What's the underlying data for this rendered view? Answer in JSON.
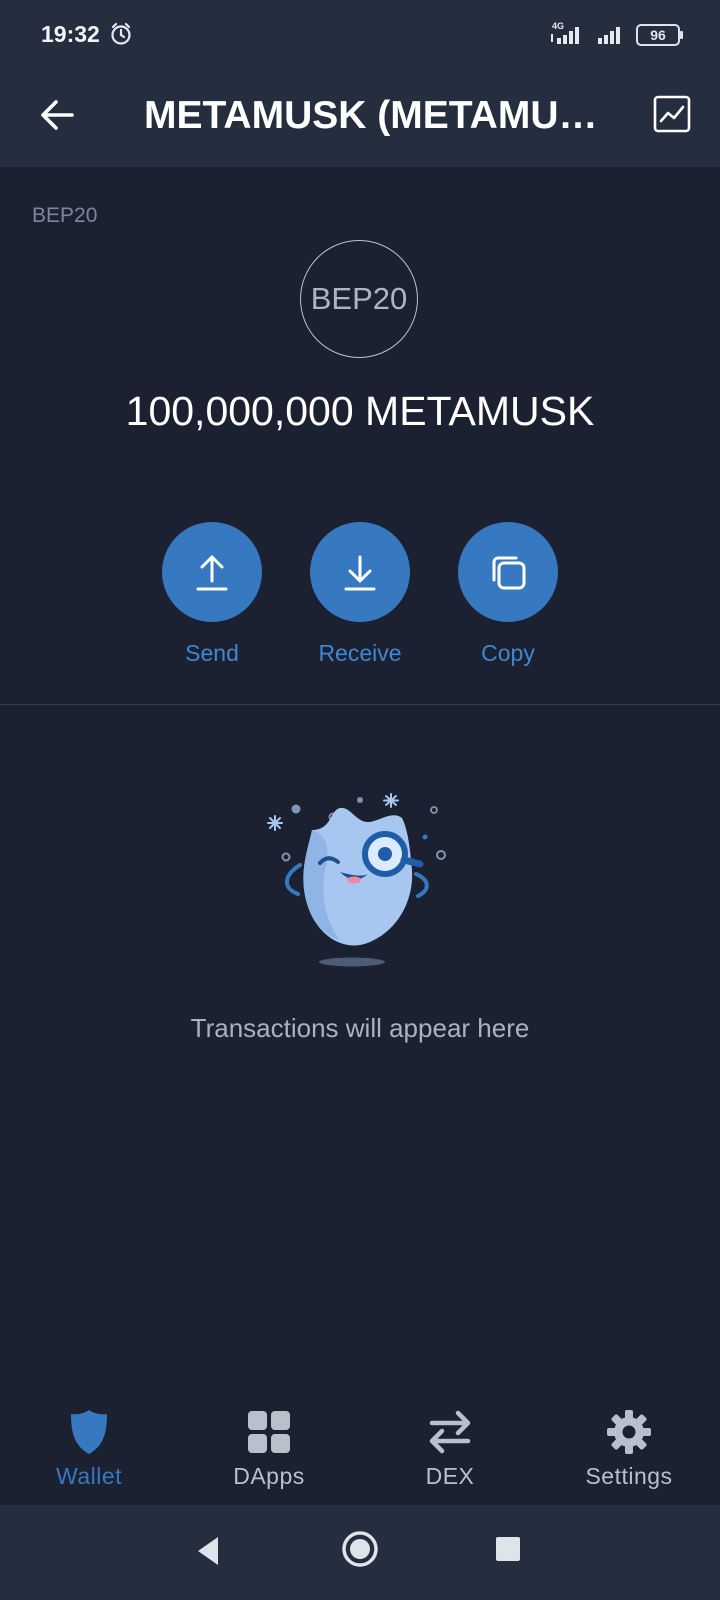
{
  "status_bar": {
    "time": "19:32",
    "network_type": "4G",
    "battery": "96"
  },
  "app_bar": {
    "title": "METAMUSK (METAMUSK)"
  },
  "token": {
    "network_label": "BEP20",
    "logo_text": "BEP20",
    "balance": "100,000,000 METAMUSK"
  },
  "actions": [
    {
      "label": "Send",
      "icon": "upload-arrow-icon"
    },
    {
      "label": "Receive",
      "icon": "download-arrow-icon"
    },
    {
      "label": "Copy",
      "icon": "copy-icon"
    }
  ],
  "empty_state": {
    "message": "Transactions will appear here"
  },
  "bottom_nav": {
    "items": [
      {
        "label": "Wallet",
        "icon": "shield-icon",
        "active": true
      },
      {
        "label": "DApps",
        "icon": "grid-icon",
        "active": false
      },
      {
        "label": "DEX",
        "icon": "swap-arrows-icon",
        "active": false
      },
      {
        "label": "Settings",
        "icon": "gear-icon",
        "active": false
      }
    ]
  },
  "colors": {
    "background": "#1b2130",
    "bar": "#252e3f",
    "accent": "#3679c0"
  }
}
